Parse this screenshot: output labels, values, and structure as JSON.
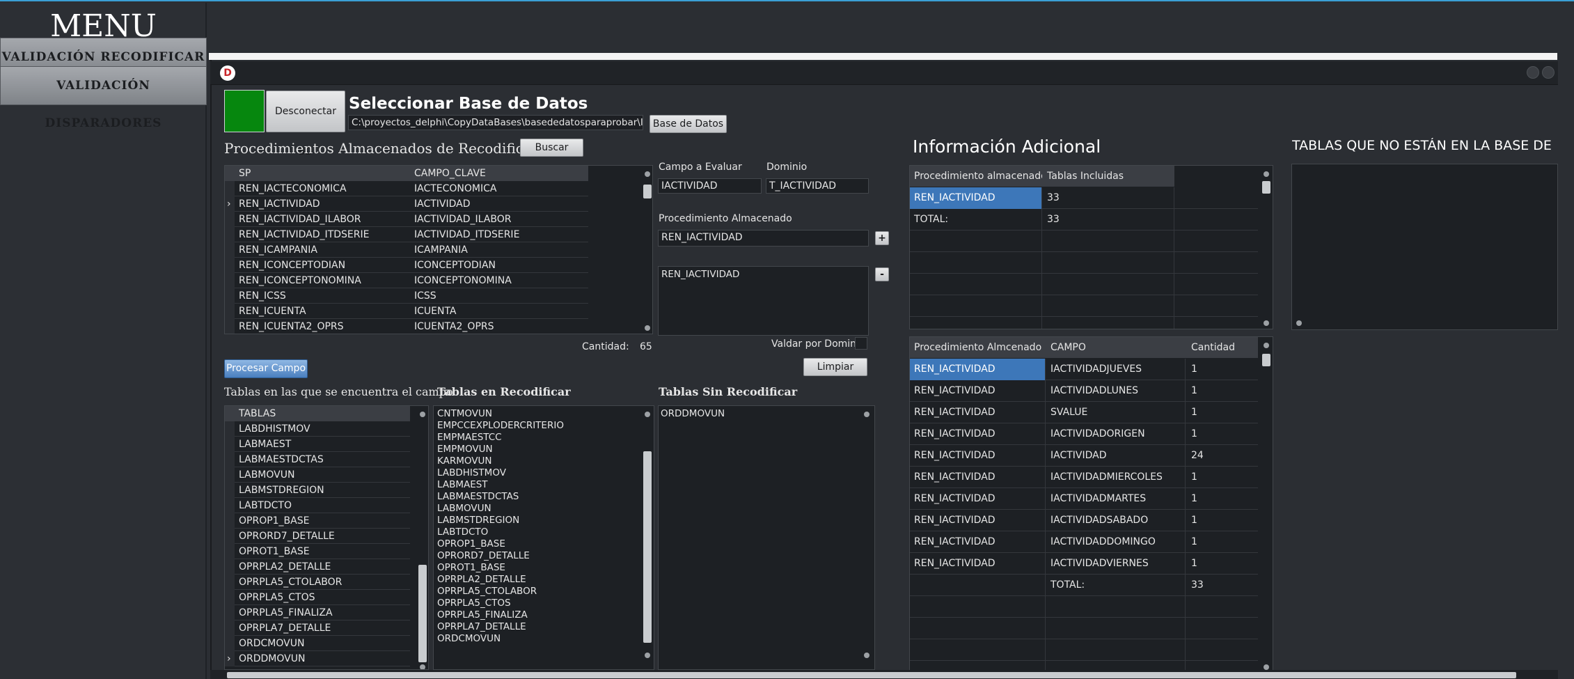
{
  "menu": {
    "title": "MENU",
    "items": [
      "VALIDACIÓN RECODIFICAR",
      "VALIDACIÓN DISPARADORES"
    ]
  },
  "window": {
    "logo": "D"
  },
  "db": {
    "disconnect_label": "Desconectar BD",
    "title": "Seleccionar Base de Datos",
    "path": "C:\\proyectos_delphi\\CopyDataBases\\basededatosparaprobar\\IS_ST",
    "db_button": "Base de Datos"
  },
  "sp_section": {
    "title": "Procedimientos Almacenados de Recodifica",
    "search_label": "Buscar",
    "columns": [
      "SP",
      "CAMPO_CLAVE"
    ],
    "rows": [
      [
        "REN_IACTECONOMICA",
        "IACTECONOMICA"
      ],
      [
        "REN_IACTIVIDAD",
        "IACTIVIDAD"
      ],
      [
        "REN_IACTIVIDAD_ILABOR",
        "IACTIVIDAD_ILABOR"
      ],
      [
        "REN_IACTIVIDAD_ITDSERIE",
        "IACTIVIDAD_ITDSERIE"
      ],
      [
        "REN_ICAMPANIA",
        "ICAMPANIA"
      ],
      [
        "REN_ICONCEPTODIAN",
        "ICONCEPTODIAN"
      ],
      [
        "REN_ICONCEPTONOMINA",
        "ICONCEPTONOMINA"
      ],
      [
        "REN_ICSS",
        "ICSS"
      ],
      [
        "REN_ICUENTA",
        "ICUENTA"
      ],
      [
        "REN_ICUENTA2_OPRS",
        "ICUENTA2_OPRS"
      ]
    ],
    "current_row_marker": "›",
    "count_label": "Cantidad:",
    "count_value": "65"
  },
  "field": {
    "campo_label": "Campo a Evaluar",
    "campo_value": "IACTIVIDAD",
    "dominio_label": "Dominio",
    "dominio_value": "T_IACTIVIDAD",
    "proc_label": "Procedimiento Almacenado",
    "proc_value": "REN_IACTIVIDAD",
    "add_label": "+",
    "remove_label": "-",
    "proc_list": [
      "REN_IACTIVIDAD"
    ],
    "validate_label": "Valdar por Dominio",
    "clear_label": "Limpiar"
  },
  "process_label": "Procesar Campo",
  "tables_found": {
    "title": "Tablas en las que se encuentra el campo",
    "header": "TABLAS",
    "rows": [
      "LABDHISTMOV",
      "LABMAEST",
      "LABMAESTDCTAS",
      "LABMOVUN",
      "LABMSTDREGION",
      "LABTDCTO",
      "OPROP1_BASE",
      "OPRORD7_DETALLE",
      "OPROT1_BASE",
      "OPRPLA2_DETALLE",
      "OPRPLA5_CTOLABOR",
      "OPRPLA5_CTOS",
      "OPRPLA5_FINALIZA",
      "OPRPLA7_DETALLE",
      "ORDCMOVUN",
      "ORDDMOVUN"
    ]
  },
  "tables_recod": {
    "title": "Tablas en Recodificar",
    "rows": [
      "CNTMOVUN",
      "EMPCCEXPLODERCRITERIO",
      "EMPMAESTCC",
      "EMPMOVUN",
      "KARMOVUN",
      "LABDHISTMOV",
      "LABMAEST",
      "LABMAESTDCTAS",
      "LABMOVUN",
      "LABMSTDREGION",
      "LABTDCTO",
      "OPROP1_BASE",
      "OPRORD7_DETALLE",
      "OPROT1_BASE",
      "OPRPLA2_DETALLE",
      "OPRPLA5_CTOLABOR",
      "OPRPLA5_CTOS",
      "OPRPLA5_FINALIZA",
      "OPRPLA7_DETALLE",
      "ORDCMOVUN"
    ]
  },
  "tables_no_recod": {
    "title": "Tablas Sin Recodificar",
    "rows": [
      "ORDDMOVUN"
    ]
  },
  "info": {
    "title": "Información Adicional",
    "columns": [
      "Procedimiento almacenado",
      "Tablas Incluidas"
    ],
    "rows": [
      [
        "REN_IACTIVIDAD",
        "33"
      ],
      [
        "TOTAL:",
        "33"
      ]
    ]
  },
  "detail": {
    "columns": [
      "Procedimiento Almcenado",
      "CAMPO",
      "Cantidad"
    ],
    "rows": [
      [
        "REN_IACTIVIDAD",
        "IACTIVIDADJUEVES",
        "1"
      ],
      [
        "REN_IACTIVIDAD",
        "IACTIVIDADLUNES",
        "1"
      ],
      [
        "REN_IACTIVIDAD",
        "SVALUE",
        "1"
      ],
      [
        "REN_IACTIVIDAD",
        "IACTIVIDADORIGEN",
        "1"
      ],
      [
        "REN_IACTIVIDAD",
        "IACTIVIDAD",
        "24"
      ],
      [
        "REN_IACTIVIDAD",
        "IACTIVIDADMIERCOLES",
        "1"
      ],
      [
        "REN_IACTIVIDAD",
        "IACTIVIDADMARTES",
        "1"
      ],
      [
        "REN_IACTIVIDAD",
        "IACTIVIDADSABADO",
        "1"
      ],
      [
        "REN_IACTIVIDAD",
        "IACTIVIDADDOMINGO",
        "1"
      ],
      [
        "REN_IACTIVIDAD",
        "IACTIVIDADVIERNES",
        "1"
      ],
      [
        "",
        "TOTAL:",
        "33"
      ]
    ]
  },
  "missing": {
    "title": "TABLAS QUE NO ESTÁN EN LA BASE DE DA"
  }
}
